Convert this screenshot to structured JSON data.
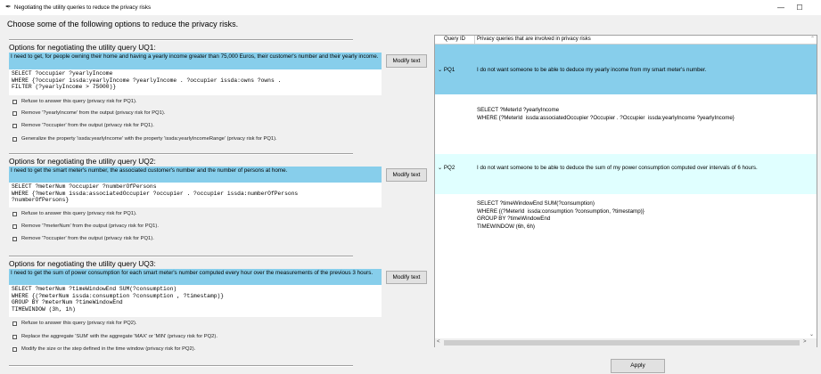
{
  "window": {
    "title": "Negotiating the utility queries to reduce the privacy risks",
    "minimize_glyph": "—",
    "maximize_glyph": "☐"
  },
  "heading": "Choose some of the following options to reduce the privacy risks.",
  "modify_label": "Modify text",
  "apply_label": "Apply",
  "groups": [
    {
      "title": "Options for negotiating the utility query UQ1:",
      "need": "I need to get, for people owning their home and having a yearly income greater than 75,000 Euros, their customer's number and their yearly income.",
      "query": "SELECT ?occupier ?yearlyIncome\nWHERE {?occupier issda:yearlyIncome ?yearlyIncome . ?occupier issda:owns ?owns .\nFILTER (?yearlyIncome > 75000)}",
      "options": [
        "Refuse to answer this query (privacy risk for PQ1).",
        "Remove '?yearlyIncome' from the output (privacy risk for PQ1).",
        "Remove '?occupier' from the output (privacy risk for PQ1).",
        "Generalize the property 'issda:yearlyIncome' with the property 'issda:yearlyIncomeRange' (privacy risk for PQ1)."
      ]
    },
    {
      "title": "Options for negotiating the utility query UQ2:",
      "need": "I need to get the smart meter's number, the associated customer's number and the number of persons at home.",
      "query": "SELECT ?meterNum ?occupier ?numberOfPersons\nWHERE {?meterNum issda:associatedOccupier ?occupier . ?occupier issda:numberOfPersons\n?numberOfPersons}",
      "options": [
        "Refuse to answer this query (privacy risk for PQ1).",
        "Remove '?meterNum' from the output (privacy risk for PQ1).",
        "Remove '?occupier' from the output (privacy risk for PQ1)."
      ]
    },
    {
      "title": "Options for negotiating the utility query UQ3:",
      "need": "I need to get the sum of power consumption for each smart meter's number computed every hour over the measurements of the previous 3 hours.",
      "query": "SELECT ?meterNum ?timeWindowEnd SUM(?consumption)\nWHERE {(?meterNum issda:consumption ?consumption , ?timestamp)}\nGROUP BY ?meterNum ?timeWindowEnd\nTIMEWINDOW (3h, 1h)",
      "options": [
        "Refuse to answer this query (privacy risk for PQ2).",
        "Replace the aggregate 'SUM' with the aggregate 'MAX' or 'MIN' (privacy risk for PQ2).",
        "Modify the size or the step defined in the time window (privacy risk for PQ2)."
      ]
    }
  ],
  "tree": {
    "col_id": "Query ID",
    "col_desc": "Privacy queries that are involved in privacy risks",
    "rows": [
      {
        "id": "PQ1",
        "arrow": "⌄",
        "text": "I do not want someone to be able to deduce my yearly income from my smart meter's number.",
        "query": "SELECT ?MeterId ?yearlyIncome\nWHERE {?MeterId  issda:associatedOccupier ?Occupier . ?Occupier  issda:yearlyIncome ?yearlyIncome}"
      },
      {
        "id": "PQ2",
        "arrow": "⌄",
        "text": "I do not want someone to be able to deduce the sum of my power consumption computed over intervals of 6 hours.",
        "query": "SELECT ?timeWindowEnd SUM(?consumption)\nWHERE {(?MeterId  issda:consumption ?consumption, ?timestamp)}\nGROUP BY ?timeWindowEnd\nTIMEWINDOW (6h, 6h)"
      }
    ]
  }
}
